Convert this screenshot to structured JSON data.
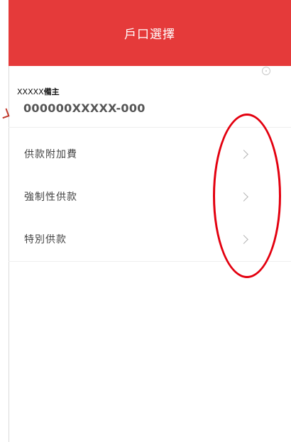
{
  "header": {
    "title": "戶口選擇"
  },
  "account": {
    "owner_prefix": "XXXXX",
    "owner_suffix": "備主",
    "number": "000000XXXXX-000"
  },
  "menu": {
    "items": [
      {
        "label": "供款附加費"
      },
      {
        "label": "強制性供款"
      },
      {
        "label": "特別供款"
      }
    ]
  },
  "colors": {
    "header_background": "#e53a3a",
    "annotation": "#e3000f"
  },
  "icons": {
    "info": "info-circle-icon",
    "chevron": "chevron-right-icon"
  }
}
